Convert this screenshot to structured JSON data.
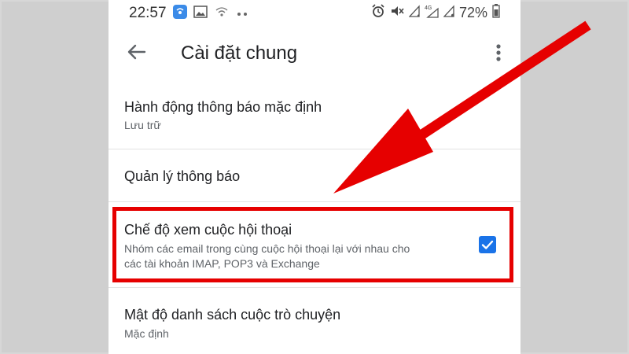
{
  "status_bar": {
    "time": "22:57",
    "battery": "72%",
    "left_icons": [
      "hotspot-icon",
      "image-icon",
      "wifi-calling-icon",
      "more-dots-icon"
    ],
    "right_icons": [
      "alarm-icon",
      "mute-icon",
      "signal-icon",
      "4g-signal-icon",
      "signal-icon",
      "battery-icon"
    ]
  },
  "header": {
    "title": "Cài đặt chung",
    "back_icon": "back-arrow-icon",
    "more_icon": "more-vert-icon"
  },
  "settings": [
    {
      "title": "Hành động thông báo mặc định",
      "subtitle": "Lưu trữ"
    },
    {
      "title": "Quản lý thông báo"
    },
    {
      "title": "Chế độ xem cuộc hội thoại",
      "subtitle_line1": "Nhóm các email trong cùng cuộc hội thoại lại với nhau cho",
      "subtitle_line2": "các tài khoản IMAP, POP3 và Exchange",
      "checked": true
    },
    {
      "title": "Mật độ danh sách cuộc trò chuyện",
      "subtitle": "Mặc định"
    }
  ],
  "colors": {
    "annotation": "#e60000",
    "checkbox": "#1a73e8"
  }
}
